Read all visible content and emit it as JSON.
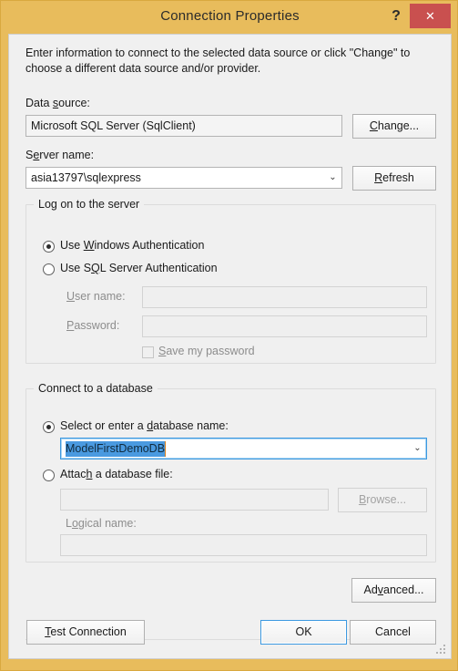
{
  "window": {
    "title": "Connection Properties",
    "help_label": "?",
    "close_label": "✕"
  },
  "intro": "Enter information to connect to the selected data source or click \"Change\" to choose a different data source and/or provider.",
  "data_source": {
    "label_pre": "Data ",
    "label_accel": "s",
    "label_post": "ource:",
    "value": "Microsoft SQL Server (SqlClient)",
    "change_pre": "",
    "change_accel": "C",
    "change_post": "hange..."
  },
  "server_name": {
    "label_pre": "S",
    "label_accel": "e",
    "label_post": "rver name:",
    "value": "asia13797\\sqlexpress",
    "dropdown_icon": "⌄",
    "refresh_pre": "",
    "refresh_accel": "R",
    "refresh_post": "efresh"
  },
  "logon_group": {
    "title": "Log on to the server",
    "windows_auth": {
      "pre": "Use ",
      "accel": "W",
      "post": "indows Authentication",
      "checked": true
    },
    "sql_auth": {
      "pre": "Use S",
      "accel": "Q",
      "post": "L Server Authentication",
      "checked": false
    },
    "username": {
      "label_pre": "",
      "label_accel": "U",
      "label_post": "ser name:",
      "value": ""
    },
    "password": {
      "label_pre": "",
      "label_accel": "P",
      "label_post": "assword:",
      "value": ""
    },
    "save_password": {
      "pre": "",
      "accel": "S",
      "post": "ave my password",
      "checked": false
    }
  },
  "database_group": {
    "title": "Connect to a database",
    "select_db": {
      "pre": "Select or enter a ",
      "accel": "d",
      "post": "atabase name:",
      "checked": true,
      "value": "ModelFirstDemoDB",
      "dropdown_icon": "⌄"
    },
    "attach_db": {
      "pre": "Attac",
      "accel": "h",
      "post": " a database file:",
      "checked": false,
      "value": "",
      "browse_pre": "",
      "browse_accel": "B",
      "browse_post": "rowse..."
    },
    "logical_name": {
      "label_pre": "L",
      "label_accel": "o",
      "label_post": "gical name:",
      "value": ""
    }
  },
  "advanced": {
    "pre": "Ad",
    "accel": "v",
    "post": "anced..."
  },
  "footer": {
    "test_connection_pre": "",
    "test_connection_accel": "T",
    "test_connection_post": "est Connection",
    "ok": "OK",
    "cancel": "Cancel"
  },
  "colors": {
    "titlebar": "#e8bc5c",
    "close_button": "#c9504f",
    "client": "#f0f0f0",
    "focus_border": "#3c99e0",
    "selection": "#4a9ae0"
  }
}
